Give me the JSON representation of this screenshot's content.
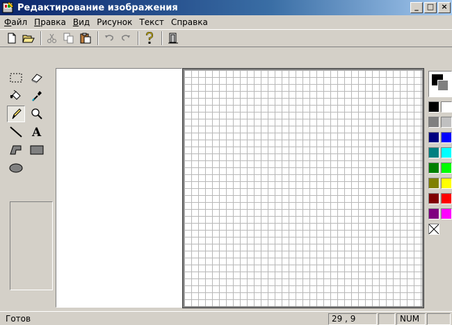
{
  "window": {
    "title": "Редактирование изображения",
    "btn_min": "_",
    "btn_max": "□",
    "btn_close": "×"
  },
  "menu": {
    "items": [
      {
        "u": "Ф",
        "rest": "айл"
      },
      {
        "u": "П",
        "rest": "равка"
      },
      {
        "u": "В",
        "rest": "ид"
      },
      {
        "u": "",
        "rest": "Рисунок"
      },
      {
        "u": "",
        "rest": "Текст"
      },
      {
        "u": "",
        "rest": "Справка"
      }
    ]
  },
  "toolbar": {
    "buttons": [
      "new-file",
      "open-file",
      "cut",
      "copy",
      "paste",
      "undo",
      "redo",
      "help",
      "exit"
    ]
  },
  "toolbox": {
    "tools": [
      "free-select",
      "select-rect",
      "eraser",
      "fill",
      "pick-color",
      "pencil",
      "magnifier",
      "line",
      "text",
      "polygon",
      "rectangle",
      "ellipse"
    ],
    "active": "pencil"
  },
  "palette": {
    "foreground": "#000000",
    "background": "#808080",
    "colors": [
      "#000000",
      "#ffffff",
      "#808080",
      "#c0c0c0",
      "#000080",
      "#0000ff",
      "#008080",
      "#00ffff",
      "#008000",
      "#00ff00",
      "#808000",
      "#ffff00",
      "#800000",
      "#ff0000",
      "#800080",
      "#ff00ff"
    ]
  },
  "status": {
    "text": "Готов",
    "coords": "29 , 9",
    "num": "NUM"
  }
}
